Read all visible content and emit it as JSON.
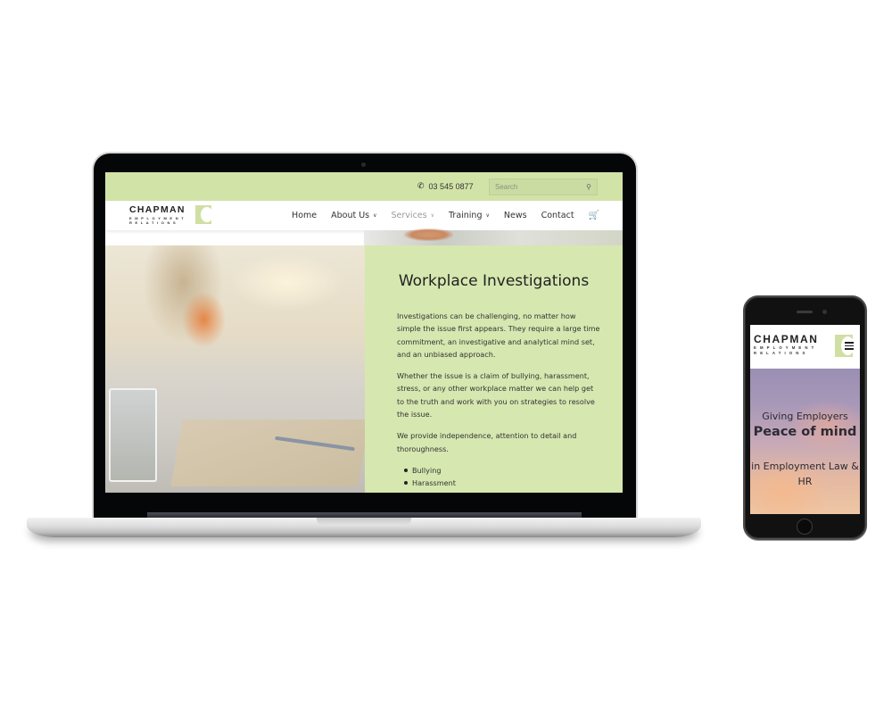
{
  "desktop_site": {
    "topbar": {
      "phone_icon": "phone-icon",
      "phone_number": "03 545 0877",
      "search_placeholder": "Search",
      "search_icon": "search-icon"
    },
    "logo": {
      "name": "CHAPMAN",
      "line1": "EMPLOYMENT",
      "line2": "RELATIONS"
    },
    "nav": [
      {
        "label": "Home",
        "has_dropdown": false
      },
      {
        "label": "About Us",
        "has_dropdown": true
      },
      {
        "label": "Services",
        "has_dropdown": true,
        "state": "muted"
      },
      {
        "label": "Training",
        "has_dropdown": true
      },
      {
        "label": "News",
        "has_dropdown": false
      },
      {
        "label": "Contact",
        "has_dropdown": false
      }
    ],
    "chevron_glyph": "∨",
    "cart_icon": "cart-icon",
    "content": {
      "title": "Workplace Investigations",
      "paragraphs": [
        "Investigations can be challenging, no matter how simple the issue first appears. They require a large time commitment, an investigative and analytical mind set, and an unbiased approach.",
        "Whether the issue is a claim of bullying, harassment, stress, or any other workplace matter we can help get to the truth and work with you on strategies to resolve the issue.",
        "We provide independence, attention to detail and thoroughness."
      ],
      "list": [
        "Bullying",
        "Harassment"
      ]
    }
  },
  "mobile_site": {
    "logo": {
      "name": "CHAPMAN",
      "line1": "EMPLOYMENT",
      "line2": "RELATIONS"
    },
    "menu_icon": "hamburger-icon",
    "hero": {
      "line1": "Giving Employers",
      "line2": "Peace of mind",
      "line3": "in Employment Law & HR"
    }
  },
  "colors": {
    "brand_green": "#d2e3a8",
    "content_green": "#d6e7b0",
    "text_dark": "#222222"
  }
}
